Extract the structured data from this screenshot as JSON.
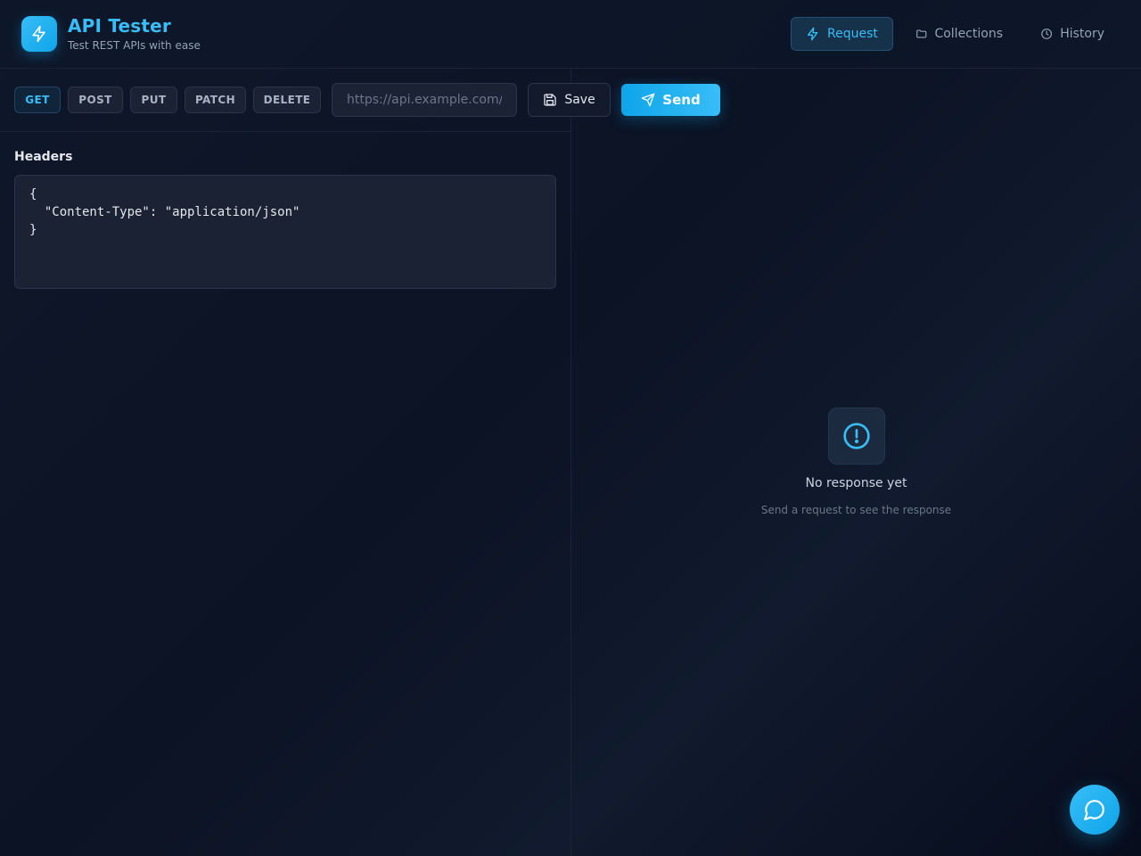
{
  "header": {
    "title": "API Tester",
    "subtitle": "Test REST APIs with ease",
    "logo_icon": "lightning-icon",
    "nav": [
      {
        "label": "Request",
        "icon": "lightning-icon",
        "active": true
      },
      {
        "label": "Collections",
        "icon": "folder-icon",
        "active": false
      },
      {
        "label": "History",
        "icon": "clock-icon",
        "active": false
      }
    ]
  },
  "request": {
    "methods": [
      "GET",
      "POST",
      "PUT",
      "PATCH",
      "DELETE"
    ],
    "selected_method": "GET",
    "url": {
      "value": "",
      "placeholder": "https://api.example.com/..."
    },
    "save_label": "Save",
    "save_icon": "floppy-disk-icon",
    "send_label": "Send",
    "send_icon": "paper-plane-icon",
    "headers_label": "Headers",
    "headers_value": "{\n  \"Content-Type\": \"application/json\"\n}"
  },
  "response": {
    "empty_icon": "alert-circle-icon",
    "empty_title": "No response yet",
    "empty_subtitle": "Send a request to see the response"
  },
  "chat": {
    "icon": "chat-bubble-icon"
  },
  "colors": {
    "accent": "#38bdf8",
    "accent_dark": "#0ea5e9",
    "background": "#0f172a",
    "panel": "#1a2233"
  }
}
